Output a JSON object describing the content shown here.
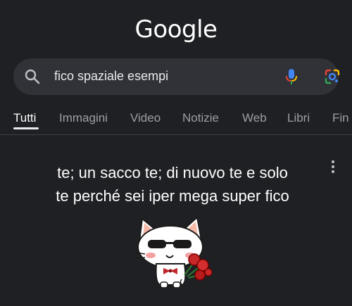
{
  "logo": "Google",
  "search": {
    "query": "fico spaziale esempi",
    "icons": [
      "search-icon",
      "mic-icon",
      "google-lens-icon"
    ]
  },
  "tabs": [
    {
      "label": "Tutti",
      "active": true
    },
    {
      "label": "Immagini"
    },
    {
      "label": "Video"
    },
    {
      "label": "Notizie"
    },
    {
      "label": "Web"
    },
    {
      "label": "Libri"
    },
    {
      "label": "Fin"
    }
  ],
  "result": {
    "line1": "te; un sacco te; di nuovo te e solo",
    "line2": "te perché sei iper mega super fico",
    "menu_icon": "more-vert-icon",
    "image": "cartoon-cat-with-roses"
  },
  "colors": {
    "background": "#1f2023",
    "searchbar": "#303237",
    "text": "#ffffff",
    "muted": "#9aa0a6"
  }
}
